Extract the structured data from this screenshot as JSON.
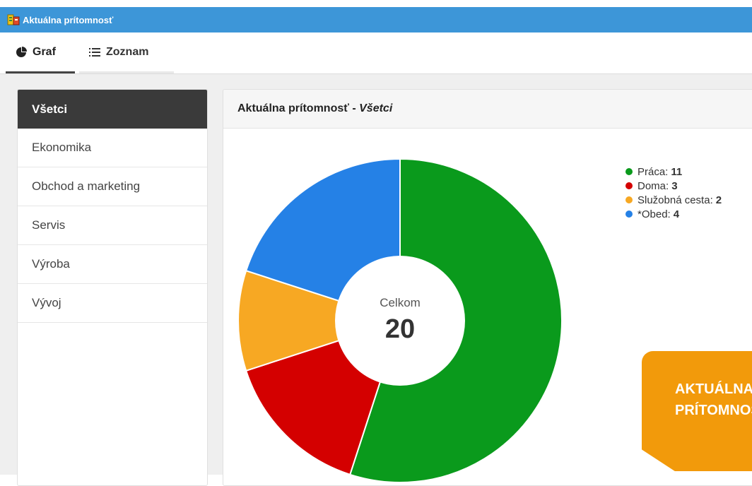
{
  "window": {
    "title": "Aktuálna prítomnosť"
  },
  "tabs": [
    {
      "label": "Graf",
      "icon": "pie-chart-icon",
      "active": true
    },
    {
      "label": "Zoznam",
      "icon": "list-icon",
      "active": false
    }
  ],
  "sidebar": {
    "items": [
      {
        "label": "Všetci",
        "active": true
      },
      {
        "label": "Ekonomika"
      },
      {
        "label": "Obchod a marketing"
      },
      {
        "label": "Servis"
      },
      {
        "label": "Výroba"
      },
      {
        "label": "Vývoj"
      }
    ]
  },
  "panel": {
    "title": "Aktuálna prítomnosť - ",
    "title_filter": "Všetci"
  },
  "chart_data": {
    "type": "pie",
    "donut": true,
    "center_label": "Celkom",
    "center_value": "20",
    "series": [
      {
        "name": "Práca",
        "value": 11,
        "color": "#0a9a1c"
      },
      {
        "name": "Doma",
        "value": 3,
        "color": "#d40000"
      },
      {
        "name": "Služobná cesta",
        "value": 2,
        "color": "#f7a823"
      },
      {
        "name": "*Obed",
        "value": 4,
        "color": "#2581e6"
      }
    ],
    "legend_position": "top-right"
  },
  "legend": [
    {
      "label": "Práca:",
      "value": "11"
    },
    {
      "label": "Doma:",
      "value": "3"
    },
    {
      "label": "Služobná cesta:",
      "value": "2"
    },
    {
      "label": "*Obed:",
      "value": "4"
    }
  ],
  "promo": {
    "line1": "AKTUÁLNA",
    "line2": "PRÍTOMNOSŤ"
  },
  "colors": {
    "titlebar": "#3d96d8",
    "sidebar_active": "#3a3a3a",
    "promo": "#f29a0b"
  }
}
